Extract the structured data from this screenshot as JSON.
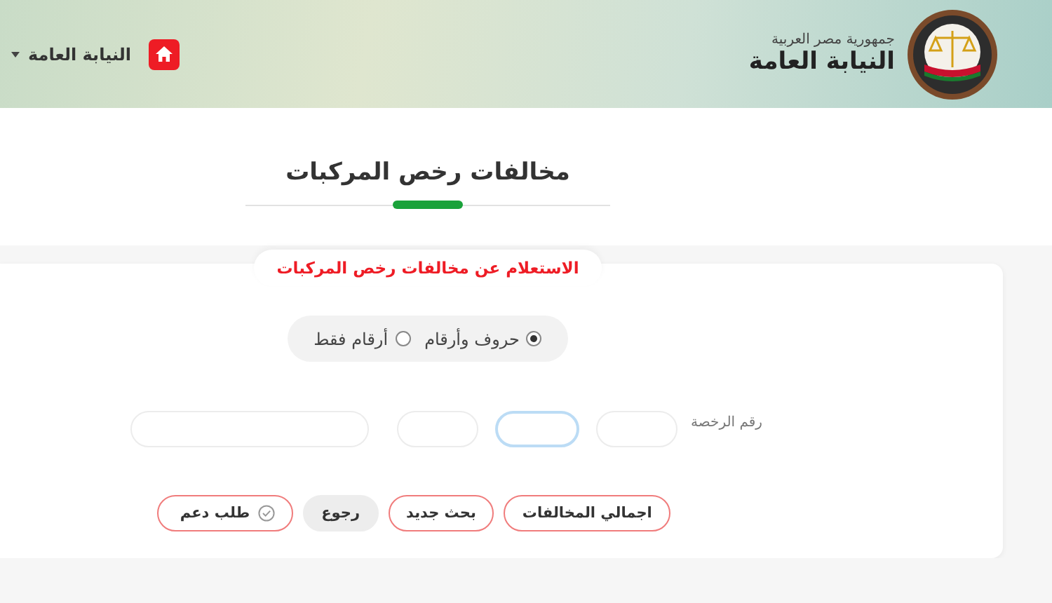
{
  "header": {
    "country": "جمهورية مصر العربية",
    "agency": "النيابة العامة",
    "menu_label": "النيابة العامة"
  },
  "page_title": "مخالفات رخص المركبات",
  "card": {
    "tab_label": "الاستعلام عن مخالفات رخص المركبات",
    "radios": [
      {
        "label": "حروف وأرقام",
        "selected": true
      },
      {
        "label": "أرقام فقط",
        "selected": false
      }
    ],
    "license_label": "رقم الرخصة",
    "fields": [
      {
        "focused": false
      },
      {
        "focused": true
      },
      {
        "focused": false
      },
      {
        "focused": false
      }
    ],
    "buttons": [
      {
        "label": "اجمالي المخالفات",
        "kind": "outlined"
      },
      {
        "label": "بحث جديد",
        "kind": "outlined"
      },
      {
        "label": "رجوع",
        "kind": "filled"
      },
      {
        "label": "طلب دعم",
        "kind": "support"
      }
    ]
  }
}
